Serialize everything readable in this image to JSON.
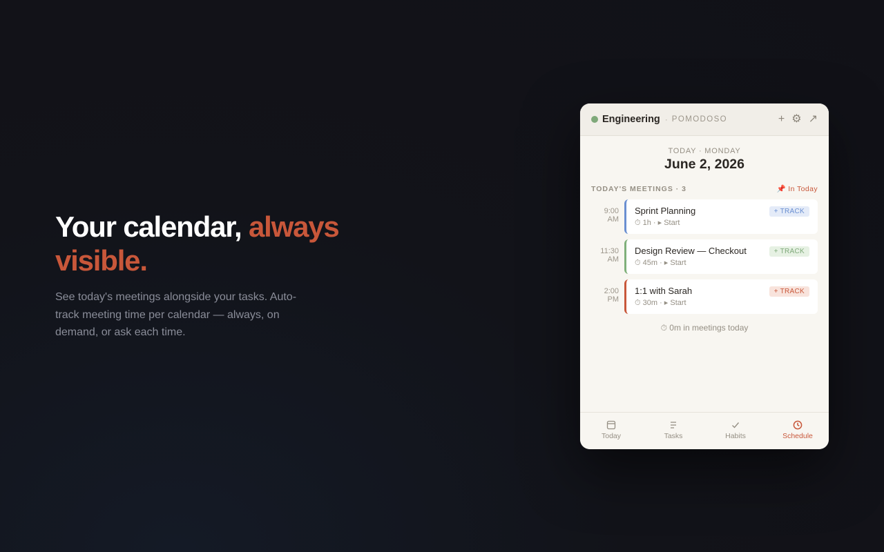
{
  "hero": {
    "headline_main": "Your calendar,",
    "headline_accent": "always visible.",
    "body": "See today's meetings alongside your tasks. Auto-track meeting time per calendar — always, on demand, or ask each time."
  },
  "widget": {
    "header": {
      "calendar_name": "Engineering",
      "separator": "·",
      "brand": "POMODOSO",
      "actions": {
        "add": "+",
        "settings": "⚙",
        "popout": "↗"
      }
    },
    "date": {
      "eyebrow": "TODAY · MONDAY",
      "main": "June 2, 2026"
    },
    "section": {
      "label": "TODAY'S MEETINGS · 3",
      "pin_link": "📌 In Today"
    },
    "meetings": [
      {
        "time": "9:00",
        "ampm": "AM",
        "title": "Sprint Planning",
        "meta": "⏱ 1h · ▸ Start",
        "track": "+ TRACK",
        "color": "#6a8fd1",
        "track_bg": "#e4ebf8",
        "track_color": "#6a8fd1"
      },
      {
        "time": "11:30",
        "ampm": "AM",
        "title": "Design Review — Checkout",
        "meta": "⏱ 45m · ▸ Start",
        "track": "+ TRACK",
        "color": "#7fb07a",
        "track_bg": "#e6f1e3",
        "track_color": "#7fa97a"
      },
      {
        "time": "2:00",
        "ampm": "PM",
        "title": "1:1 with Sarah",
        "meta": "⏱ 30m · ▸ Start",
        "track": "+ TRACK",
        "color": "#c8573a",
        "track_bg": "#f8e3dc",
        "track_color": "#c8573a"
      }
    ],
    "summary": "⏱ 0m in meetings today",
    "nav": [
      {
        "label": "Today",
        "icon": "calendar-icon"
      },
      {
        "label": "Tasks",
        "icon": "list-icon"
      },
      {
        "label": "Habits",
        "icon": "check-icon"
      },
      {
        "label": "Schedule",
        "icon": "clock-icon",
        "active": true
      }
    ],
    "colors": {
      "accent": "#c8573a",
      "status_dot": "#7fa97a"
    }
  }
}
